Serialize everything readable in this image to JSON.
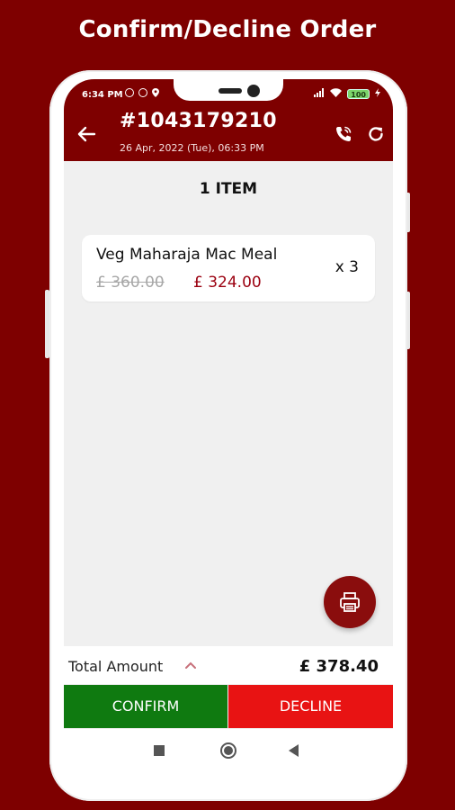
{
  "promo": {
    "title": "Confirm/Decline Order"
  },
  "status_bar": {
    "time": "6:34 PM",
    "battery": "100"
  },
  "header": {
    "order_number": "#1043179210",
    "order_datetime": "26 Apr, 2022 (Tue), 06:33 PM"
  },
  "items_header": "1 ITEM",
  "items": [
    {
      "name": "Veg Maharaja Mac Meal",
      "quantity": "x 3",
      "original_price": "£ 360.00",
      "price": "£ 324.00"
    }
  ],
  "summary": {
    "total_label": "Total Amount",
    "total_value": "£ 378.40"
  },
  "actions": {
    "confirm": "CONFIRM",
    "decline": "DECLINE"
  },
  "icons": {
    "back": "arrow-left-icon",
    "call": "phone-call-icon",
    "refresh": "refresh-icon",
    "print": "printer-icon",
    "expand": "chevron-up-icon"
  },
  "colors": {
    "brand": "#7e0000",
    "confirm": "#0f7a10",
    "decline": "#e81313",
    "price": "#9b0010"
  }
}
